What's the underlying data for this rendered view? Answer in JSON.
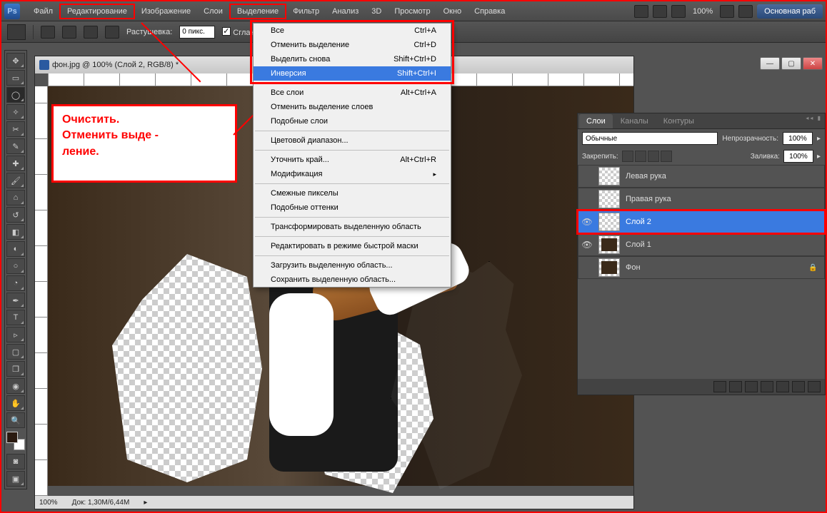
{
  "app": {
    "logo": "Ps"
  },
  "menu": {
    "items": [
      "Файл",
      "Редактирование",
      "Изображение",
      "Слои",
      "Выделение",
      "Фильтр",
      "Анализ",
      "3D",
      "Просмотр",
      "Окно",
      "Справка"
    ],
    "boxed": [
      1,
      4
    ]
  },
  "toolbar_right": {
    "zoom": "100%",
    "workspace": "Основная раб"
  },
  "options": {
    "feather_label": "Растушевка:",
    "feather_value": "0 пикс.",
    "antialias": "Сглаживан"
  },
  "document": {
    "title": "фон.jpg @ 100% (Слой 2, RGB/8) *",
    "status_zoom": "100%",
    "status_doc": "Док: 1,30M/6,44M"
  },
  "annotation": {
    "line1": "Очистить.",
    "line2": "Отменить выде -",
    "line3": "ление."
  },
  "dropdown": {
    "groups": [
      [
        {
          "label": "Все",
          "shortcut": "Ctrl+A"
        },
        {
          "label": "Отменить выделение",
          "shortcut": "Ctrl+D"
        },
        {
          "label": "Выделить снова",
          "shortcut": "Shift+Ctrl+D"
        },
        {
          "label": "Инверсия",
          "shortcut": "Shift+Ctrl+I",
          "highlight": true
        }
      ],
      [
        {
          "label": "Все слои",
          "shortcut": "Alt+Ctrl+A"
        },
        {
          "label": "Отменить выделение слоев",
          "shortcut": ""
        },
        {
          "label": "Подобные слои",
          "shortcut": ""
        }
      ],
      [
        {
          "label": "Цветовой диапазон...",
          "shortcut": ""
        }
      ],
      [
        {
          "label": "Уточнить край...",
          "shortcut": "Alt+Ctrl+R"
        },
        {
          "label": "Модификация",
          "shortcut": "",
          "sub": true
        }
      ],
      [
        {
          "label": "Смежные пикселы",
          "shortcut": ""
        },
        {
          "label": "Подобные оттенки",
          "shortcut": ""
        }
      ],
      [
        {
          "label": "Трансформировать выделенную область",
          "shortcut": ""
        }
      ],
      [
        {
          "label": "Редактировать в режиме быстрой маски",
          "shortcut": ""
        }
      ],
      [
        {
          "label": "Загрузить выделенную область...",
          "shortcut": ""
        },
        {
          "label": "Сохранить выделенную область...",
          "shortcut": ""
        }
      ]
    ]
  },
  "layers_panel": {
    "tabs": [
      "Слои",
      "Каналы",
      "Контуры"
    ],
    "blend": "Обычные",
    "opacity_label": "Непрозрачность:",
    "opacity": "100%",
    "lock_label": "Закрепить:",
    "fill_label": "Заливка:",
    "fill": "100%",
    "layers": [
      {
        "eye": false,
        "name": "Левая рука"
      },
      {
        "eye": false,
        "name": "Правая рука"
      },
      {
        "eye": true,
        "name": "Слой 2",
        "selected": true
      },
      {
        "eye": true,
        "name": "Слой 1",
        "dark": true
      },
      {
        "eye": false,
        "name": "Фон",
        "dark": true,
        "locked": true
      }
    ]
  }
}
